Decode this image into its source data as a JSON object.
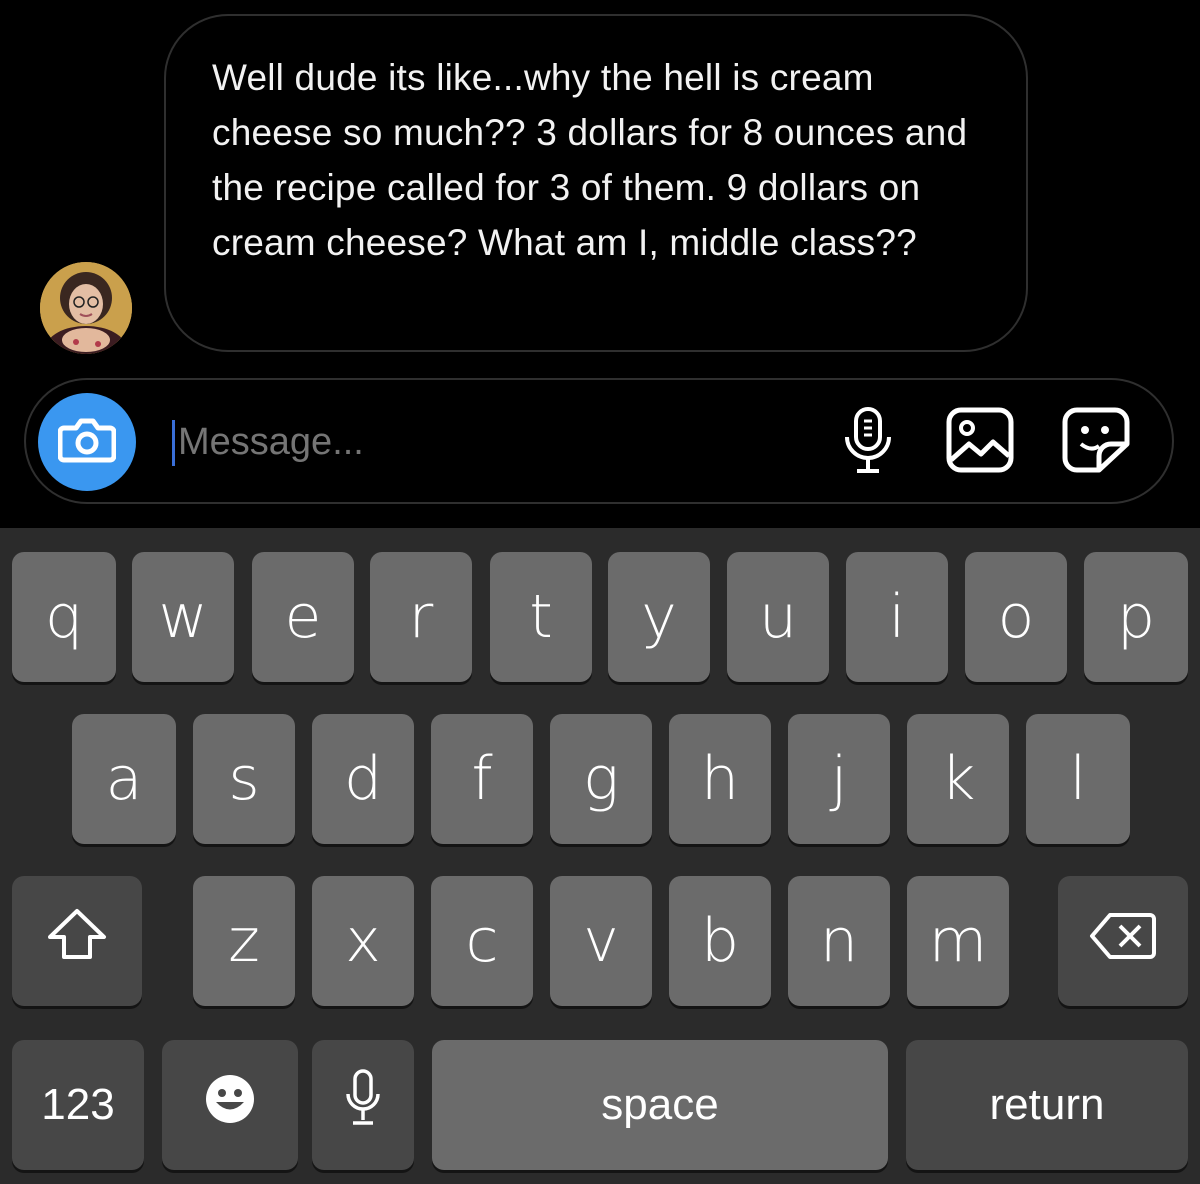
{
  "message": {
    "text": "Well dude its like...why the hell is cream cheese so much?? 3 dollars for 8 ounces and the recipe called for 3 of them. 9 dollars on cream cheese? What am I, middle class??"
  },
  "composer": {
    "placeholder": "Message...",
    "icons": [
      "camera-icon",
      "microphone-icon",
      "image-icon",
      "sticker-icon"
    ],
    "accent": "#3a97f0"
  },
  "keyboard": {
    "row1": [
      "q",
      "w",
      "e",
      "r",
      "t",
      "y",
      "u",
      "i",
      "o",
      "p"
    ],
    "row2": [
      "a",
      "s",
      "d",
      "f",
      "g",
      "h",
      "j",
      "k",
      "l"
    ],
    "row3": [
      "z",
      "x",
      "c",
      "v",
      "b",
      "n",
      "m"
    ],
    "numbers_label": "123",
    "space_label": "space",
    "return_label": "return",
    "icons": [
      "shift-icon",
      "backspace-icon",
      "emoji-icon",
      "dictation-icon"
    ]
  }
}
